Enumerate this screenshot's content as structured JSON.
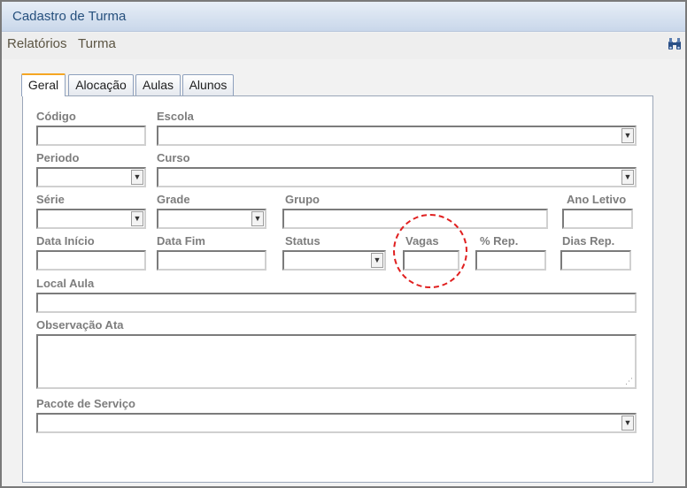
{
  "window": {
    "title": "Cadastro de Turma"
  },
  "menu": {
    "items": [
      "Relatórios",
      "Turma"
    ]
  },
  "tabs": [
    {
      "label": "Geral"
    },
    {
      "label": "Alocação"
    },
    {
      "label": "Aulas"
    },
    {
      "label": "Alunos"
    }
  ],
  "form": {
    "codigo": "Código",
    "escola": "Escola",
    "periodo": "Periodo",
    "curso": "Curso",
    "serie": "Série",
    "grade": "Grade",
    "grupo": "Grupo",
    "ano_letivo": "Ano Letivo",
    "data_inicio": "Data Início",
    "data_fim": "Data Fim",
    "status": "Status",
    "vagas": "Vagas",
    "pct_rep": "% Rep.",
    "dias_rep": "Dias Rep.",
    "local_aula": "Local Aula",
    "observacao_ata": "Observação Ata",
    "pacote_servico": "Pacote de Serviço"
  },
  "icons": {
    "search": "binoculars-icon",
    "dropdown": "chevron-down-icon"
  },
  "colors": {
    "highlight_circle": "#e02020",
    "active_tab_border": "#f5a623"
  }
}
